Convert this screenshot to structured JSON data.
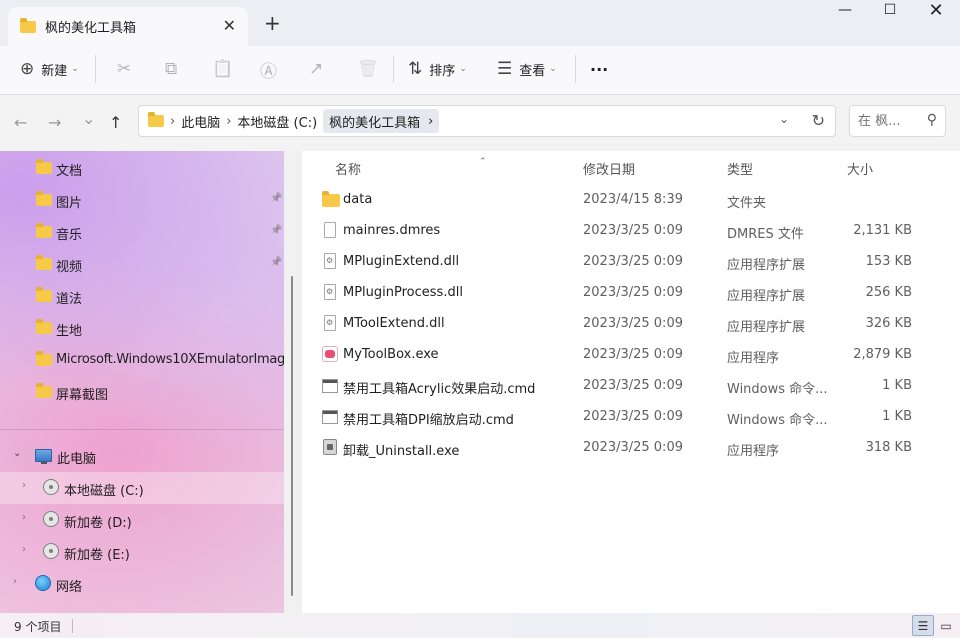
{
  "window": {
    "tab_title": "枫的美化工具箱",
    "tab_close": "✕",
    "new_tab": "+",
    "min": "—",
    "max": "☐",
    "close": "✕"
  },
  "toolbar": {
    "new_icon": "⊕",
    "new_label": "新建",
    "cut_icon": "✂",
    "copy_icon": "⧉",
    "paste_icon": "📋",
    "rename_icon": "Ⓐ",
    "share_icon": "↗",
    "delete_icon": "🗑",
    "sort_icon": "⇅",
    "sort_label": "排序",
    "view_icon": "☰",
    "view_label": "查看",
    "more_label": "···"
  },
  "nav": {
    "back": "←",
    "forward": "→",
    "recent": "⌄",
    "up": "↑"
  },
  "address": {
    "crumbs": [
      "此电脑",
      "本地磁盘 (C:)",
      "枫的美化工具箱"
    ],
    "separator": "›",
    "dropdown": "⌄",
    "refresh": "↻"
  },
  "search": {
    "placeholder": "在 枫...",
    "icon": "⚲"
  },
  "sidebar": {
    "quick": [
      {
        "label": "文档",
        "pinned": false
      },
      {
        "label": "图片",
        "pinned": true
      },
      {
        "label": "音乐",
        "pinned": true
      },
      {
        "label": "视频",
        "pinned": true
      },
      {
        "label": "道法",
        "pinned": false
      },
      {
        "label": "生地",
        "pinned": false
      },
      {
        "label": "Microsoft.Windows10XEmulatorImag",
        "pinned": false
      },
      {
        "label": "屏幕截图",
        "pinned": false
      }
    ],
    "pin_icon": "📌",
    "this_pc": "此电脑",
    "drives": [
      "本地磁盘 (C:)",
      "新加卷 (D:)",
      "新加卷 (E:)"
    ],
    "network": "网络",
    "expanded_arrow": "⌄",
    "collapsed_arrow": "›"
  },
  "columns": {
    "name": "名称",
    "date": "修改日期",
    "type": "类型",
    "size": "大小",
    "sort_arrow": "⌃"
  },
  "files": [
    {
      "name": "data",
      "date": "2023/4/15 8:39",
      "type": "文件夹",
      "size": "",
      "icon": "folder"
    },
    {
      "name": "mainres.dmres",
      "date": "2023/3/25 0:09",
      "type": "DMRES 文件",
      "size": "2,131 KB",
      "icon": "doc"
    },
    {
      "name": "MPluginExtend.dll",
      "date": "2023/3/25 0:09",
      "type": "应用程序扩展",
      "size": "153 KB",
      "icon": "dll"
    },
    {
      "name": "MPluginProcess.dll",
      "date": "2023/3/25 0:09",
      "type": "应用程序扩展",
      "size": "256 KB",
      "icon": "dll"
    },
    {
      "name": "MToolExtend.dll",
      "date": "2023/3/25 0:09",
      "type": "应用程序扩展",
      "size": "326 KB",
      "icon": "dll"
    },
    {
      "name": "MyToolBox.exe",
      "date": "2023/3/25 0:09",
      "type": "应用程序",
      "size": "2,879 KB",
      "icon": "exe-red"
    },
    {
      "name": "禁用工具箱Acrylic效果启动.cmd",
      "date": "2023/3/25 0:09",
      "type": "Windows 命令...",
      "size": "1 KB",
      "icon": "cmd"
    },
    {
      "name": "禁用工具箱DPI缩放启动.cmd",
      "date": "2023/3/25 0:09",
      "type": "Windows 命令...",
      "size": "1 KB",
      "icon": "cmd"
    },
    {
      "name": "卸载_Uninstall.exe",
      "date": "2023/3/25 0:09",
      "type": "应用程序",
      "size": "318 KB",
      "icon": "uninst"
    }
  ],
  "status": {
    "count": "9 个项目",
    "details_icon": "☰",
    "tiles_icon": "▭"
  }
}
